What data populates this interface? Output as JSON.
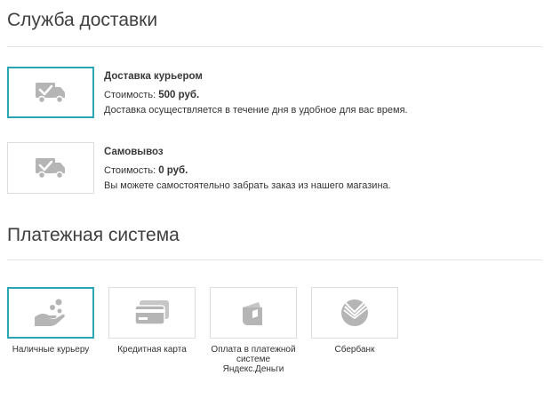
{
  "delivery": {
    "title": "Служба доставки",
    "price_prefix": "Стоимость: ",
    "options": [
      {
        "name": "Доставка курьером",
        "price": "500 руб.",
        "description": "Доставка осуществляется в течение дня в удобное для вас время.",
        "icon": "truck-check-icon",
        "selected": true
      },
      {
        "name": "Самовывоз",
        "price": "0 руб.",
        "description": "Вы можете самостоятельно забрать заказ из нашего магазина.",
        "icon": "truck-check-icon",
        "selected": false
      }
    ]
  },
  "payment": {
    "title": "Платежная система",
    "options": [
      {
        "label": "Наличные курьеру",
        "icon": "cash-hand-icon",
        "selected": true
      },
      {
        "label": "Кредитная карта",
        "icon": "credit-card-icon",
        "selected": false
      },
      {
        "label": "Оплата в платежной системе Яндекс.Деньги",
        "icon": "yandex-money-wallet-icon",
        "selected": false
      },
      {
        "label": "Сбербанк",
        "icon": "sberbank-logo-icon",
        "selected": false
      }
    ]
  },
  "colors": {
    "accent": "#2aa6b4",
    "icon": "#b5b5b5"
  }
}
